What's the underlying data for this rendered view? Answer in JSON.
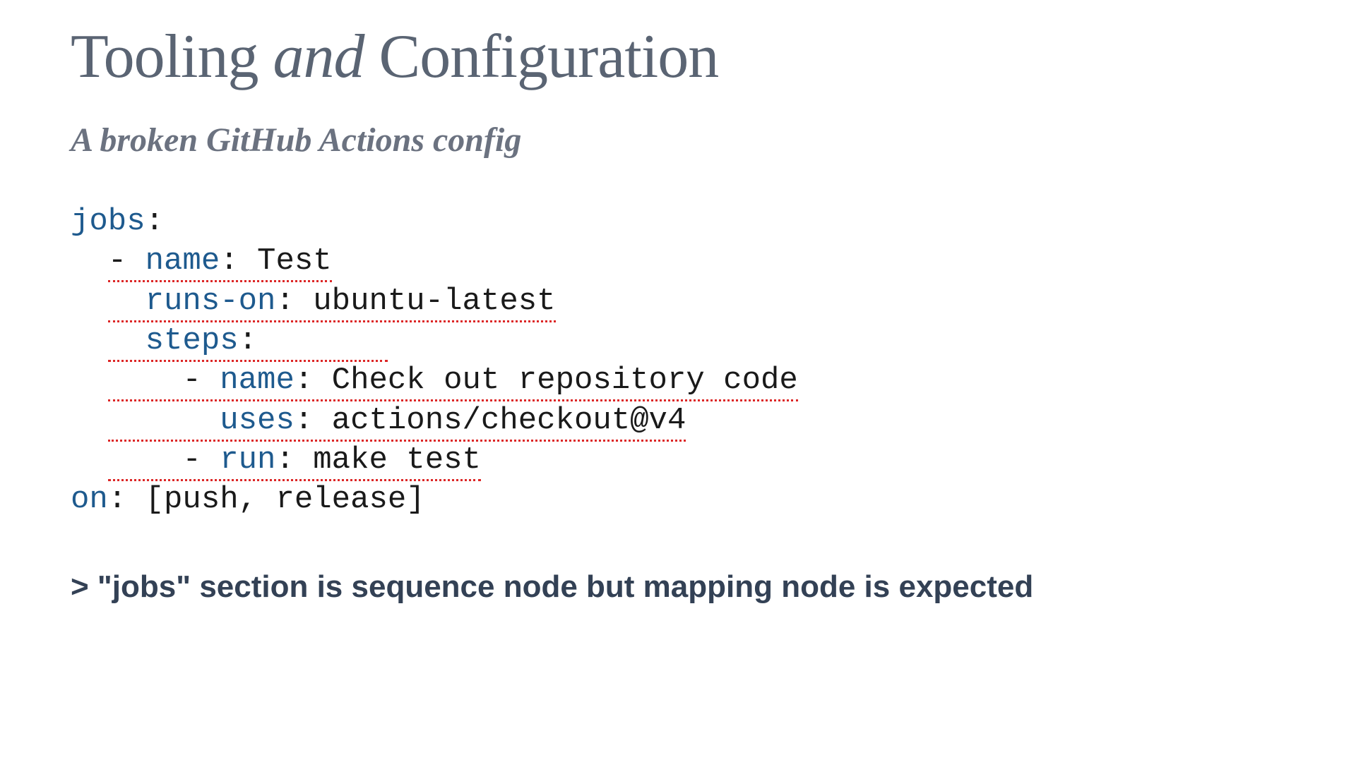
{
  "title": {
    "part1": "Tooling ",
    "italic": "and",
    "part2": " Configuration"
  },
  "subtitle": "A broken GitHub Actions config",
  "code": {
    "jobs_key": "jobs",
    "colon": ":",
    "dash": "- ",
    "name_key": "name",
    "test_value": " Test",
    "runs_on_key": "runs-on",
    "runs_on_value": " ubuntu-latest",
    "steps_key": "steps",
    "checkout_value": " Check out repository code",
    "uses_key": "uses",
    "uses_value": " actions/checkout@v4",
    "run_key": "run",
    "run_value": " make test",
    "on_key": "on",
    "on_value": " [push, release]",
    "indent1": "  ",
    "indent2": "    ",
    "indent3": "      ",
    "indent4": "        "
  },
  "error": {
    "prefix": "> ",
    "message": "\"jobs\" section is sequence node but mapping node is expected"
  }
}
